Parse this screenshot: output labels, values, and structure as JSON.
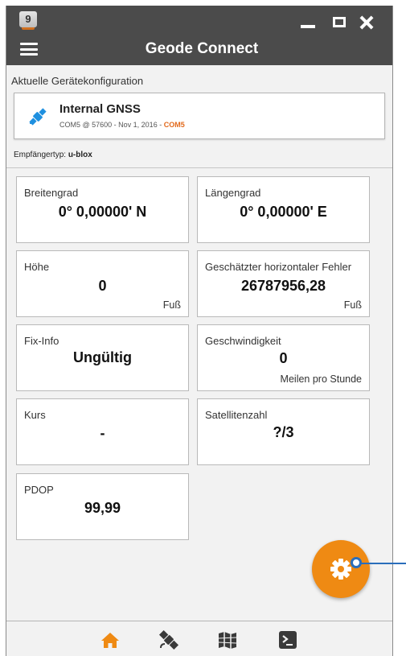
{
  "window": {
    "app_icon_text": "9",
    "title": "Geode Connect"
  },
  "config": {
    "section_label": "Aktuelle Gerätekonfiguration",
    "device_name": "Internal GNSS",
    "device_details": "COM5 @ 57600 - Nov 1, 2016 - ",
    "device_port": "COM5",
    "receiver_type_label": "Empfängertyp: ",
    "receiver_type_value": "u-blox"
  },
  "tiles": {
    "latitude": {
      "label": "Breitengrad",
      "value": "0° 0,00000' N"
    },
    "longitude": {
      "label": "Längengrad",
      "value": "0° 0,00000' E"
    },
    "altitude": {
      "label": "Höhe",
      "value": "0",
      "unit": "Fuß"
    },
    "horizontal_error": {
      "label": "Geschätzter horizontaler Fehler",
      "value": "26787956,28",
      "unit": "Fuß"
    },
    "fix_info": {
      "label": "Fix-Info",
      "value": "Ungültig"
    },
    "speed": {
      "label": "Geschwindigkeit",
      "value": "0",
      "unit": "Meilen pro Stunde"
    },
    "course": {
      "label": "Kurs",
      "value": "-"
    },
    "satellites": {
      "label": "Satellitenzahl",
      "value": "?/3"
    },
    "pdop": {
      "label": "PDOP",
      "value": "99,99"
    }
  },
  "fab": {
    "icon": "gear-icon"
  },
  "bottom_nav": [
    {
      "icon": "home-icon",
      "active": true
    },
    {
      "icon": "satellite-icon",
      "active": false
    },
    {
      "icon": "map-icon",
      "active": false
    },
    {
      "icon": "terminal-icon",
      "active": false
    }
  ],
  "colors": {
    "accent": "#ef8a13",
    "titlebar": "#4b4b4b",
    "device_icon": "#1e90e0",
    "callout": "#2a6ebb"
  }
}
